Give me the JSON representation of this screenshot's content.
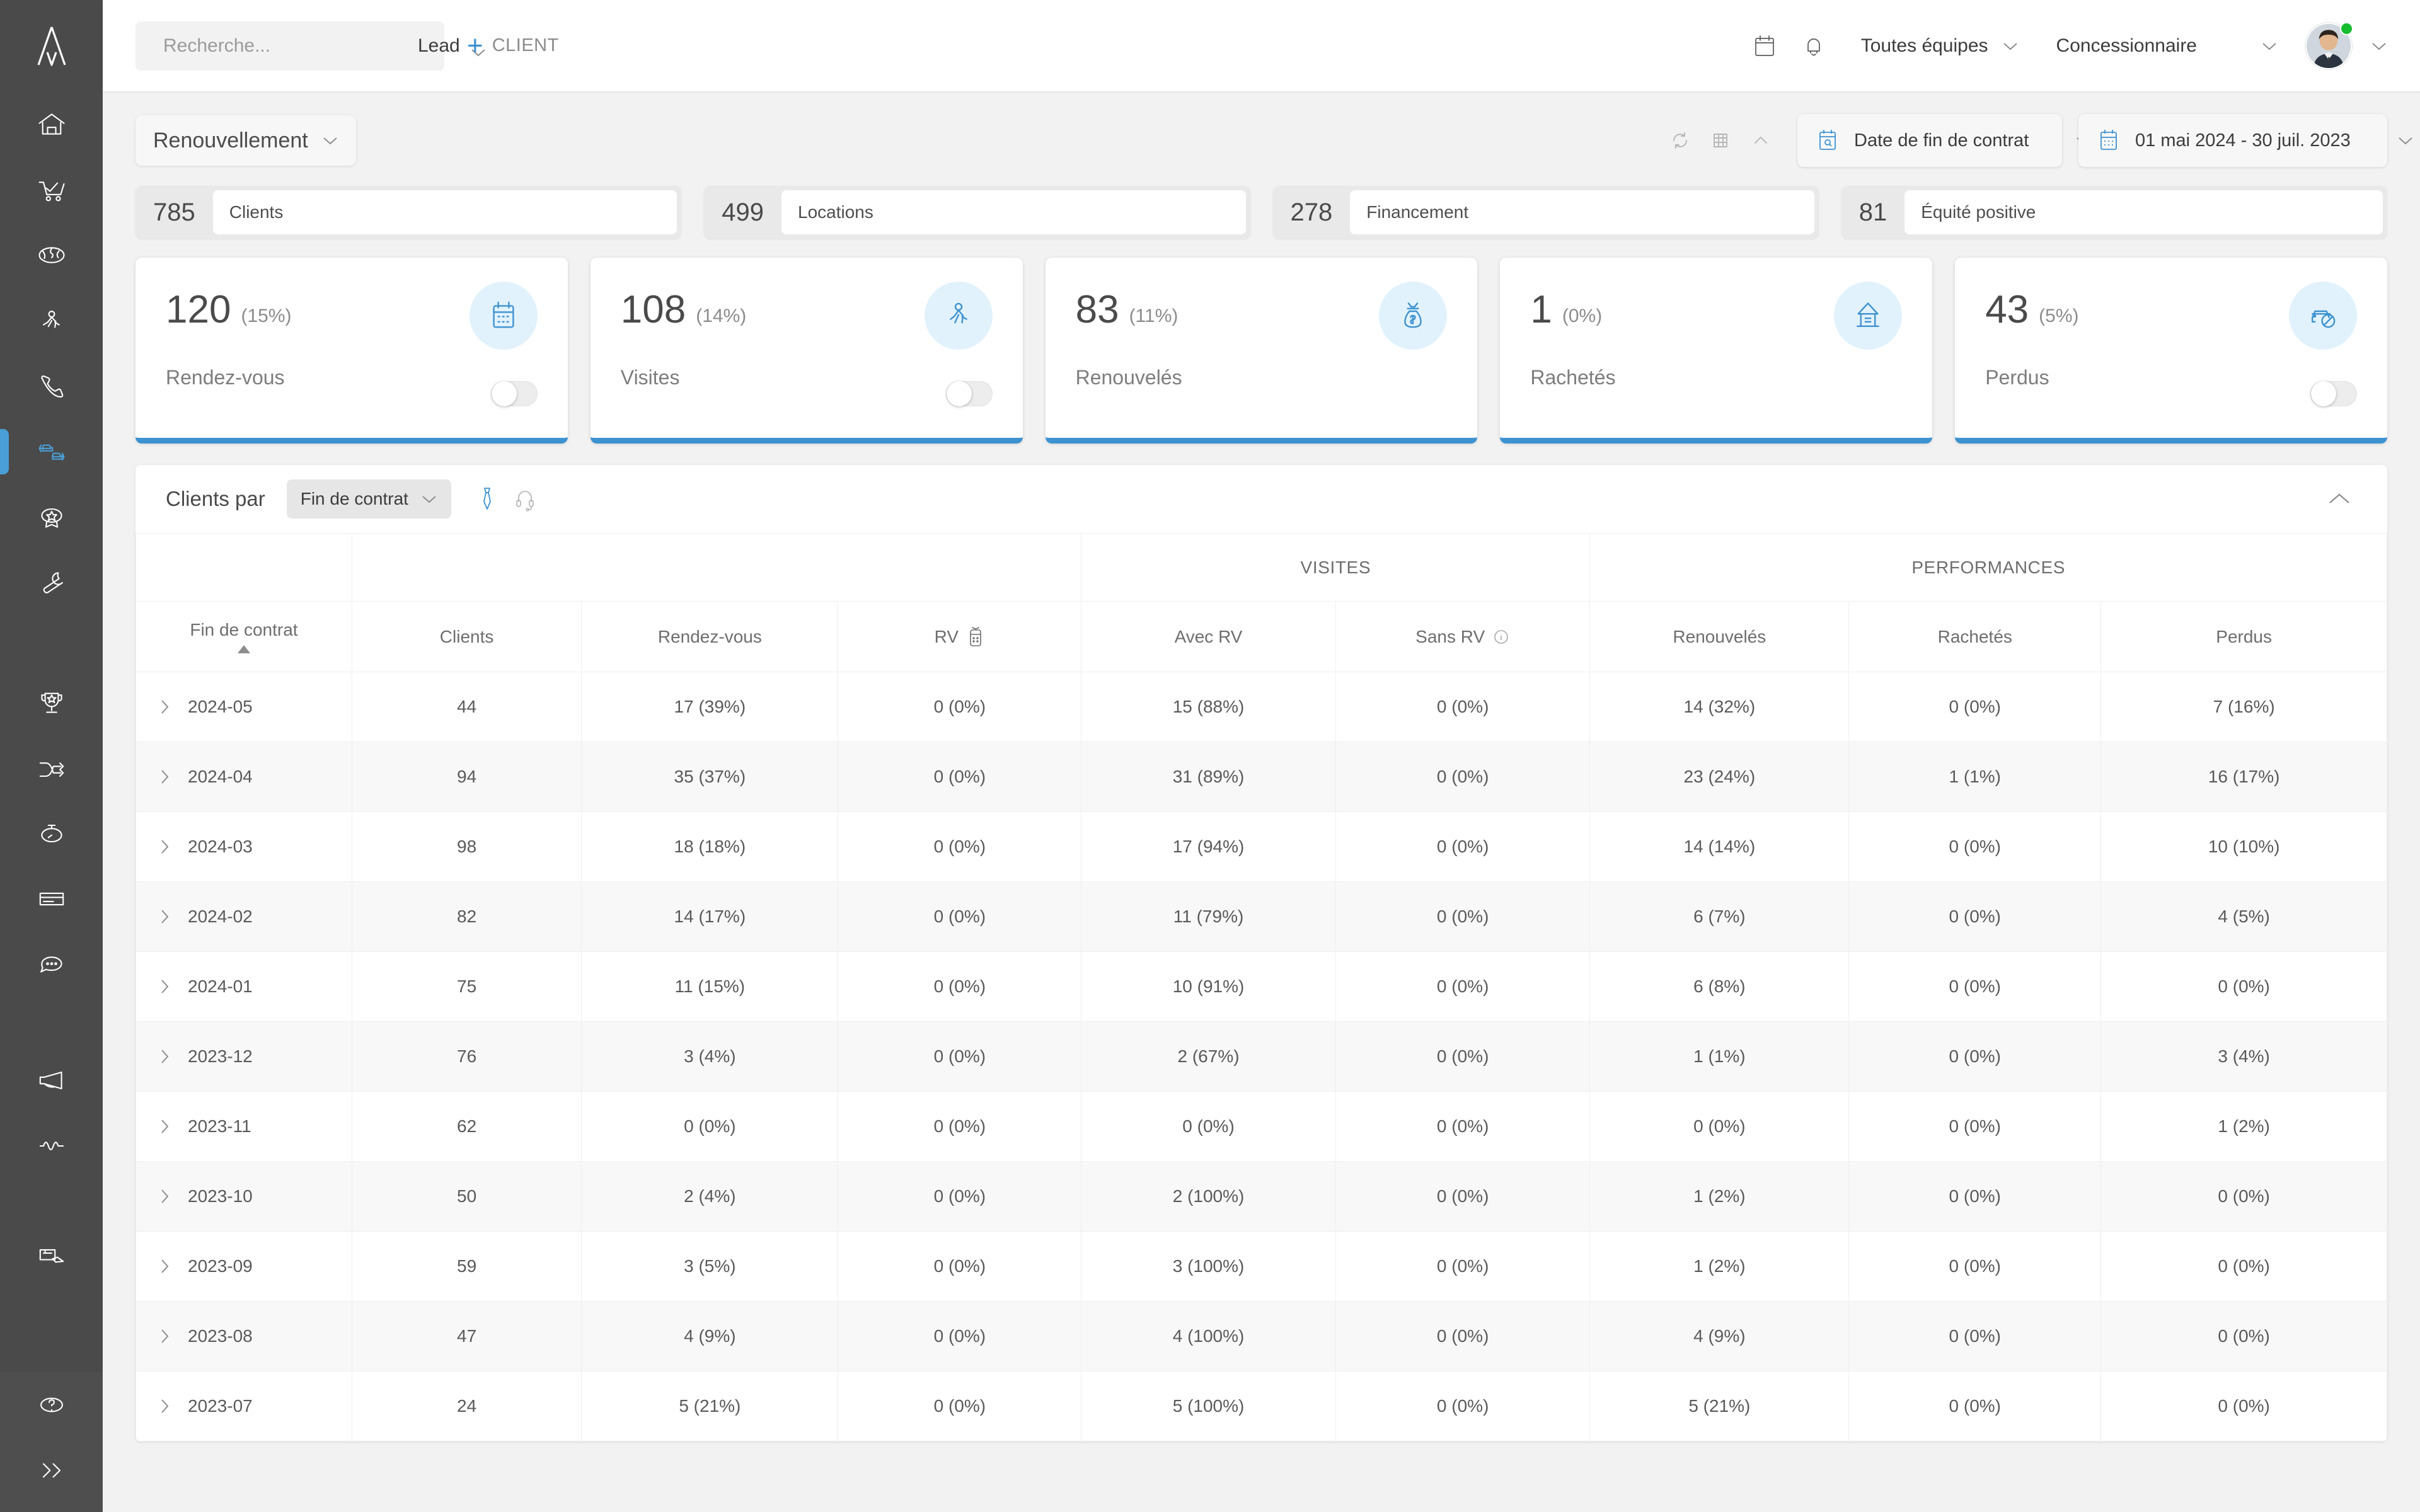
{
  "sidebar": {
    "logo": "brand-logo",
    "items": [
      {
        "name": "home",
        "icon": "home-icon"
      },
      {
        "name": "sales",
        "icon": "shopping-cart-icon"
      },
      {
        "name": "inventory",
        "icon": "globe-icon"
      },
      {
        "name": "walkin",
        "icon": "walking-person-icon"
      },
      {
        "name": "calls",
        "icon": "phone-icon"
      },
      {
        "name": "renewal",
        "icon": "car-exchange-icon",
        "active": true
      },
      {
        "name": "loyalty",
        "icon": "award-badge-icon"
      },
      {
        "name": "service",
        "icon": "wrench-icon"
      },
      {
        "name": "leaderboard",
        "icon": "trophy-icon"
      },
      {
        "name": "routing",
        "icon": "shuffle-arrows-icon"
      },
      {
        "name": "timing",
        "icon": "stopwatch-icon"
      },
      {
        "name": "billing",
        "icon": "card-icon"
      },
      {
        "name": "chat",
        "icon": "chat-bubble-icon"
      },
      {
        "name": "campaigns",
        "icon": "megaphone-icon"
      },
      {
        "name": "activity",
        "icon": "pulse-wave-icon"
      },
      {
        "name": "signature",
        "icon": "document-sign-icon"
      }
    ],
    "bottom_items": [
      {
        "name": "help",
        "icon": "question-circle-icon"
      },
      {
        "name": "expand",
        "icon": "double-chevron-right-icon"
      }
    ]
  },
  "topbar": {
    "search_placeholder": "Recherche...",
    "search_value": "",
    "search_icon": "search-icon",
    "lead_selector": "Lead",
    "add_client_label": "CLIENT",
    "add_client_icon": "plus-icon",
    "calendar_icon": "calendar-icon",
    "bell_icon": "bell-icon",
    "team_selector": "Toutes équipes",
    "role_selector": "Concessionnaire",
    "avatar": "user-avatar",
    "status": "online"
  },
  "toolbar": {
    "view_title": "Renouvellement",
    "refresh_icon": "refresh-icon",
    "export_icon": "export-grid-icon",
    "collapse_icon": "chevron-up-icon",
    "date_field_label": "Date de fin de contrat",
    "date_field_icon": "calendar-search-icon",
    "date_range_label": "01 mai 2024 - 30 juil. 2023",
    "date_range_icon": "calendar-icon"
  },
  "stats": [
    {
      "value": "785",
      "label": "Clients"
    },
    {
      "value": "499",
      "label": "Locations"
    },
    {
      "value": "278",
      "label": "Financement"
    },
    {
      "value": "81",
      "label": "Équité positive"
    }
  ],
  "kpis": [
    {
      "value": "120",
      "pct": "(15%)",
      "label": "Rendez-vous",
      "icon": "calendar-icon",
      "toggle": true,
      "toggle_on": false,
      "accent": "#3d92d0"
    },
    {
      "value": "108",
      "pct": "(14%)",
      "label": "Visites",
      "icon": "walking-person-icon",
      "toggle": true,
      "toggle_on": false,
      "accent": "#3d92d0"
    },
    {
      "value": "83",
      "pct": "(11%)",
      "label": "Renouvelés",
      "icon": "money-bag-icon",
      "toggle": false,
      "toggle_on": false,
      "accent": "#3d92d0"
    },
    {
      "value": "1",
      "pct": "(0%)",
      "label": "Rachetés",
      "icon": "bank-icon",
      "toggle": false,
      "toggle_on": false,
      "accent": "#3d92d0"
    },
    {
      "value": "43",
      "pct": "(5%)",
      "label": "Perdus",
      "icon": "car-blocked-icon",
      "toggle": true,
      "toggle_on": false,
      "accent": "#3d92d0"
    }
  ],
  "panel": {
    "title": "Clients par",
    "group_selector": "Fin de contrat",
    "tie_icon": "necktie-icon",
    "headset_icon": "headset-icon",
    "collapse_icon": "chevron-up-icon"
  },
  "table": {
    "group_headers": [
      {
        "label": "",
        "span": 1
      },
      {
        "label": "",
        "span": 3
      },
      {
        "label": "VISITES",
        "span": 2
      },
      {
        "label": "PERFORMANCES",
        "span": 3
      }
    ],
    "columns": [
      {
        "label": "Fin de contrat",
        "sorted": "asc"
      },
      {
        "label": "Clients"
      },
      {
        "label": "Rendez-vous"
      },
      {
        "label": "RV",
        "icon": "phone-calendar-icon"
      },
      {
        "label": "Avec RV"
      },
      {
        "label": "Sans RV",
        "icon": "info-icon"
      },
      {
        "label": "Renouvelés"
      },
      {
        "label": "Rachetés"
      },
      {
        "label": "Perdus"
      }
    ],
    "rows": [
      {
        "period": "2024-05",
        "clients": "44",
        "rdv": "17 (39%)",
        "rv": "0 (0%)",
        "avec_rv": "15 (88%)",
        "sans_rv": "0 (0%)",
        "renouveles": "14 (32%)",
        "rachetes": "0 (0%)",
        "perdus": "7 (16%)"
      },
      {
        "period": "2024-04",
        "clients": "94",
        "rdv": "35 (37%)",
        "rv": "0 (0%)",
        "avec_rv": "31 (89%)",
        "sans_rv": "0 (0%)",
        "renouveles": "23 (24%)",
        "rachetes": "1 (1%)",
        "perdus": "16 (17%)"
      },
      {
        "period": "2024-03",
        "clients": "98",
        "rdv": "18 (18%)",
        "rv": "0 (0%)",
        "avec_rv": "17 (94%)",
        "sans_rv": "0 (0%)",
        "renouveles": "14 (14%)",
        "rachetes": "0 (0%)",
        "perdus": "10 (10%)"
      },
      {
        "period": "2024-02",
        "clients": "82",
        "rdv": "14 (17%)",
        "rv": "0 (0%)",
        "avec_rv": "11 (79%)",
        "sans_rv": "0 (0%)",
        "renouveles": "6 (7%)",
        "rachetes": "0 (0%)",
        "perdus": "4 (5%)"
      },
      {
        "period": "2024-01",
        "clients": "75",
        "rdv": "11 (15%)",
        "rv": "0 (0%)",
        "avec_rv": "10 (91%)",
        "sans_rv": "0 (0%)",
        "renouveles": "6 (8%)",
        "rachetes": "0 (0%)",
        "perdus": "0 (0%)"
      },
      {
        "period": "2023-12",
        "clients": "76",
        "rdv": "3 (4%)",
        "rv": "0 (0%)",
        "avec_rv": "2 (67%)",
        "sans_rv": "0 (0%)",
        "renouveles": "1 (1%)",
        "rachetes": "0 (0%)",
        "perdus": "3 (4%)"
      },
      {
        "period": "2023-11",
        "clients": "62",
        "rdv": "0 (0%)",
        "rv": "0 (0%)",
        "avec_rv": "0 (0%)",
        "sans_rv": "0 (0%)",
        "renouveles": "0 (0%)",
        "rachetes": "0 (0%)",
        "perdus": "1 (2%)"
      },
      {
        "period": "2023-10",
        "clients": "50",
        "rdv": "2 (4%)",
        "rv": "0 (0%)",
        "avec_rv": "2 (100%)",
        "sans_rv": "0 (0%)",
        "renouveles": "1 (2%)",
        "rachetes": "0 (0%)",
        "perdus": "0 (0%)"
      },
      {
        "period": "2023-09",
        "clients": "59",
        "rdv": "3 (5%)",
        "rv": "0 (0%)",
        "avec_rv": "3 (100%)",
        "sans_rv": "0 (0%)",
        "renouveles": "1 (2%)",
        "rachetes": "0 (0%)",
        "perdus": "0 (0%)"
      },
      {
        "period": "2023-08",
        "clients": "47",
        "rdv": "4 (9%)",
        "rv": "0 (0%)",
        "avec_rv": "4 (100%)",
        "sans_rv": "0 (0%)",
        "renouveles": "4 (9%)",
        "rachetes": "0 (0%)",
        "perdus": "0 (0%)"
      },
      {
        "period": "2023-07",
        "clients": "24",
        "rdv": "5 (21%)",
        "rv": "0 (0%)",
        "avec_rv": "5 (100%)",
        "sans_rv": "0 (0%)",
        "renouveles": "5 (21%)",
        "rachetes": "0 (0%)",
        "perdus": "0 (0%)"
      }
    ]
  }
}
